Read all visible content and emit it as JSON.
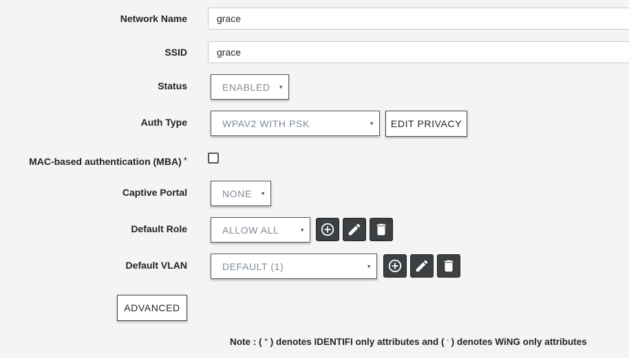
{
  "form": {
    "network_name": {
      "label": "Network Name",
      "value": "grace"
    },
    "ssid": {
      "label": "SSID",
      "value": "grace"
    },
    "status": {
      "label": "Status",
      "selected": "ENABLED"
    },
    "auth_type": {
      "label": "Auth Type",
      "selected": "WPAV2 WITH PSK",
      "edit_button": "EDIT PRIVACY"
    },
    "mba": {
      "label": "MAC-based authentication (MBA)",
      "marker": "+",
      "checked": false
    },
    "captive_portal": {
      "label": "Captive Portal",
      "selected": "NONE"
    },
    "default_role": {
      "label": "Default Role",
      "selected": "ALLOW ALL"
    },
    "default_vlan": {
      "label": "Default VLAN",
      "selected": "DEFAULT (1)"
    },
    "advanced_button": "ADVANCED"
  },
  "note": {
    "prefix": "Note : (",
    "plus": "+",
    "mid": ") denotes IDENTIFI only attributes and (",
    "minus": "-",
    "suffix": ") denotes WiNG only attributes"
  },
  "icons": {
    "caret": "▾",
    "add": "add-circle-icon",
    "edit": "pencil-icon",
    "delete": "trash-icon"
  },
  "colors": {
    "background": "#f4f4f4",
    "icon_button_bg": "#3c4043",
    "select_text": "#7f8a95"
  }
}
